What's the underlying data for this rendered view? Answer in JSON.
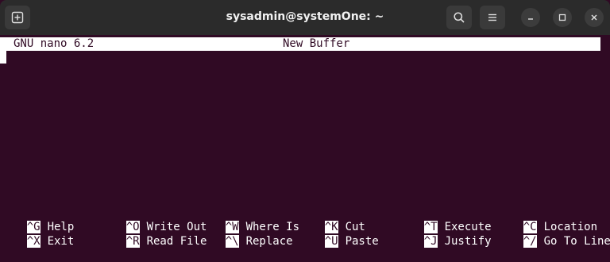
{
  "window": {
    "title": "sysadmin@systemOne: ~"
  },
  "nano": {
    "version": "GNU nano 6.2",
    "buffer": "New Buffer"
  },
  "shortcuts": [
    {
      "key": "^G",
      "label": "Help"
    },
    {
      "key": "^O",
      "label": "Write Out"
    },
    {
      "key": "^W",
      "label": "Where Is"
    },
    {
      "key": "^K",
      "label": "Cut"
    },
    {
      "key": "^T",
      "label": "Execute"
    },
    {
      "key": "^C",
      "label": "Location"
    },
    {
      "key": "^X",
      "label": "Exit"
    },
    {
      "key": "^R",
      "label": "Read File"
    },
    {
      "key": "^\\",
      "label": "Replace"
    },
    {
      "key": "^U",
      "label": "Paste"
    },
    {
      "key": "^J",
      "label": "Justify"
    },
    {
      "key": "^/",
      "label": "Go To Line"
    }
  ],
  "icons": {
    "new_tab": "new-tab-icon",
    "search": "search-icon",
    "menu": "hamburger-menu-icon",
    "minimize": "minimize-icon",
    "maximize": "maximize-icon",
    "close": "close-icon"
  },
  "colors": {
    "terminal_bg": "#300a24",
    "titlebar_bg": "#2b2b2b",
    "text": "#ffffff"
  }
}
